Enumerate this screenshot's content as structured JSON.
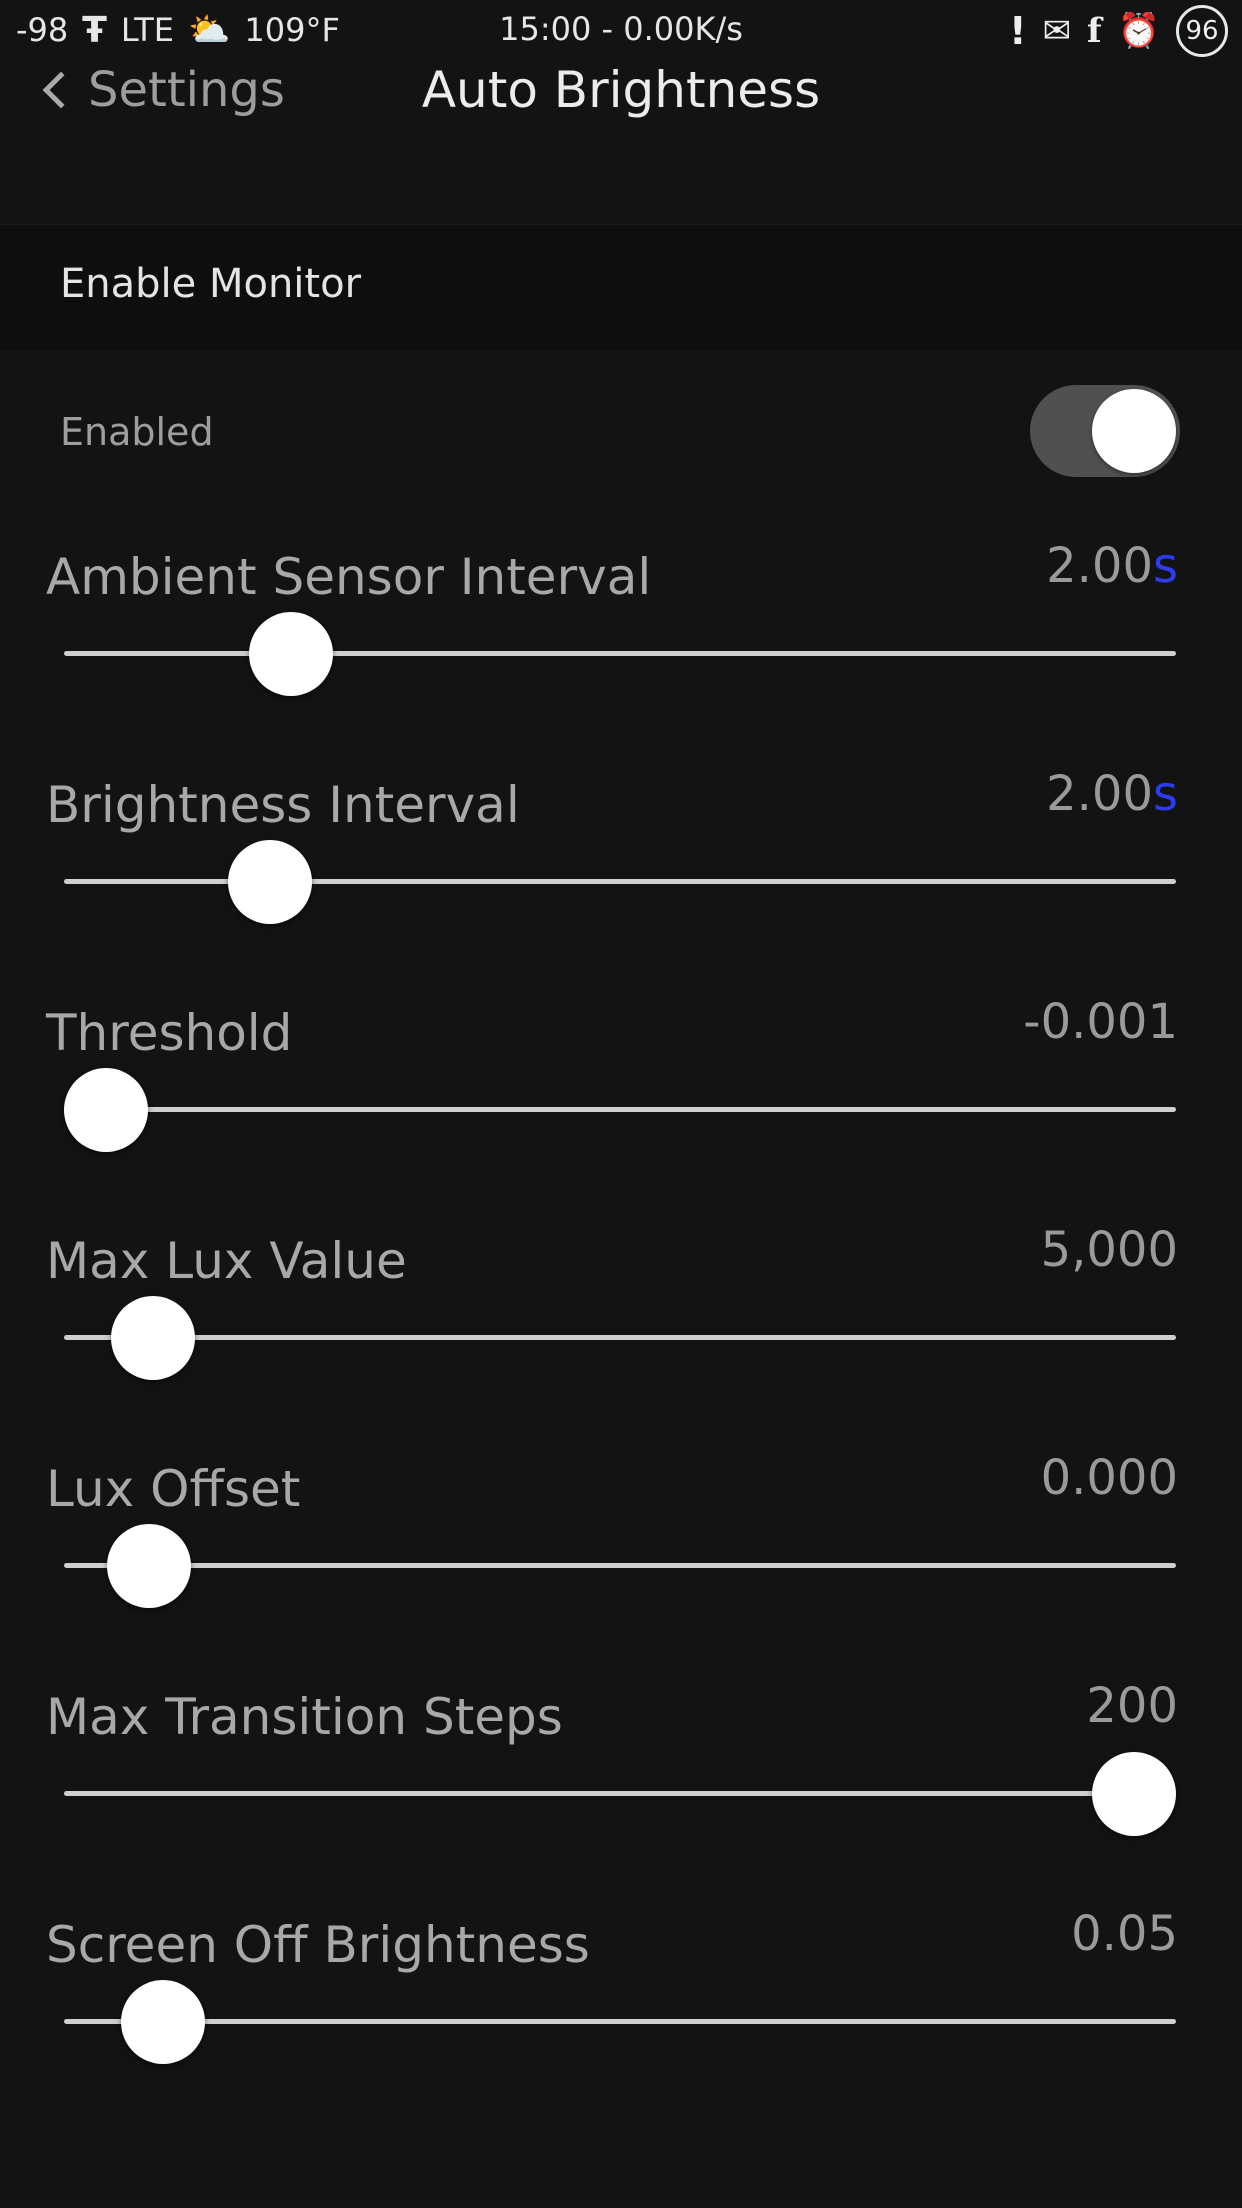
{
  "status_bar": {
    "signal": "-98",
    "network": "LTE",
    "temperature": "109°F",
    "time_speed": "15:00 - 0.00K/s",
    "battery": "96"
  },
  "nav": {
    "back_label": "Settings",
    "title": "Auto Brightness"
  },
  "section": {
    "header": "Enable Monitor",
    "toggle_label": "Enabled",
    "toggle_on": true
  },
  "sliders": [
    {
      "label": "Ambient Sensor Interval",
      "value": "2.00",
      "unit": "s",
      "fraction": 0.18
    },
    {
      "label": "Brightness Interval",
      "value": "2.00",
      "unit": "s",
      "fraction": 0.16
    },
    {
      "label": "Threshold",
      "value": "-0.001",
      "unit": "",
      "fraction": 0.0
    },
    {
      "label": "Max Lux Value",
      "value": "5,000",
      "unit": "",
      "fraction": 0.046
    },
    {
      "label": "Lux Offset",
      "value": "0.000",
      "unit": "",
      "fraction": 0.042
    },
    {
      "label": "Max Transition Steps",
      "value": "200",
      "unit": "",
      "fraction": 1.0
    },
    {
      "label": "Screen Off Brightness",
      "value": "0.05",
      "unit": "",
      "fraction": 0.055
    }
  ],
  "colors": {
    "background": "#131313",
    "unit_accent": "#2c3cf0",
    "toggle_track": "#505050",
    "knob": "#ffffff"
  }
}
